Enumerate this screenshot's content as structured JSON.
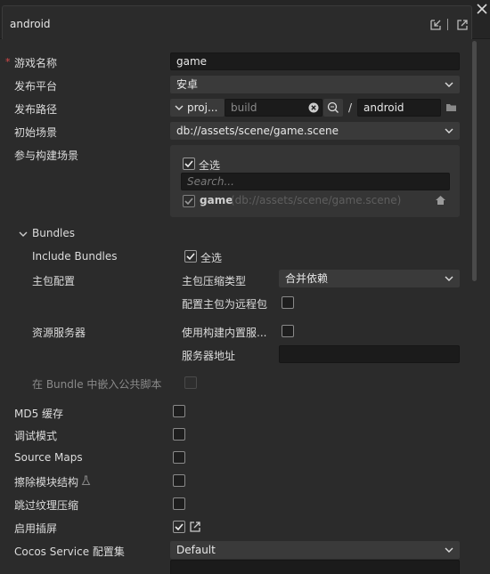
{
  "window": {
    "title": "android"
  },
  "form": {
    "game_name_label": "游戏名称",
    "game_name_value": "game",
    "platform_label": "发布平台",
    "platform_value": "安卓",
    "path_label": "发布路径",
    "path_prefix": "proj...",
    "path_build_placeholder": "build",
    "path_separator": "/",
    "path_folder": "android",
    "start_scene_label": "初始场景",
    "start_scene_value": "db://assets/scene/game.scene",
    "build_scenes_label": "参与构建场景",
    "select_all": "全选",
    "search_placeholder": "Search...",
    "scene_name": "game",
    "scene_path": "(db://assets/scene/game.scene)"
  },
  "bundles": {
    "header": "Bundles",
    "include_label": "Include Bundles",
    "include_select_all": "全选",
    "main_config_label": "主包配置",
    "compression_label": "主包压缩类型",
    "compression_value": "合并依赖",
    "remote_label": "配置主包为远程包",
    "server_label": "资源服务器",
    "use_builtin_label": "使用构建内置服...",
    "server_addr_label": "服务器地址",
    "embed_label": "在 Bundle 中嵌入公共脚本"
  },
  "options": {
    "md5_label": "MD5 缓存",
    "debug_label": "调试模式",
    "sourcemaps_label": "Source Maps",
    "erase_modules_label": "擦除模块结构",
    "skip_compress_label": "跳过纹理压缩",
    "splash_label": "启用插屏",
    "cocos_service_label": "Cocos Service 配置集",
    "cocos_service_value": "Default"
  },
  "icons": [
    "close-icon",
    "import-icon",
    "export-icon",
    "chevron-down-icon",
    "folder-icon",
    "clear-icon",
    "search-icon",
    "home-icon",
    "checkmark-icon",
    "edit-icon",
    "flask-icon"
  ],
  "colors": {
    "background": "#2b2b2b",
    "field": "#1b1b1b",
    "select": "#3a3a3a",
    "required": "#d84a4a"
  }
}
